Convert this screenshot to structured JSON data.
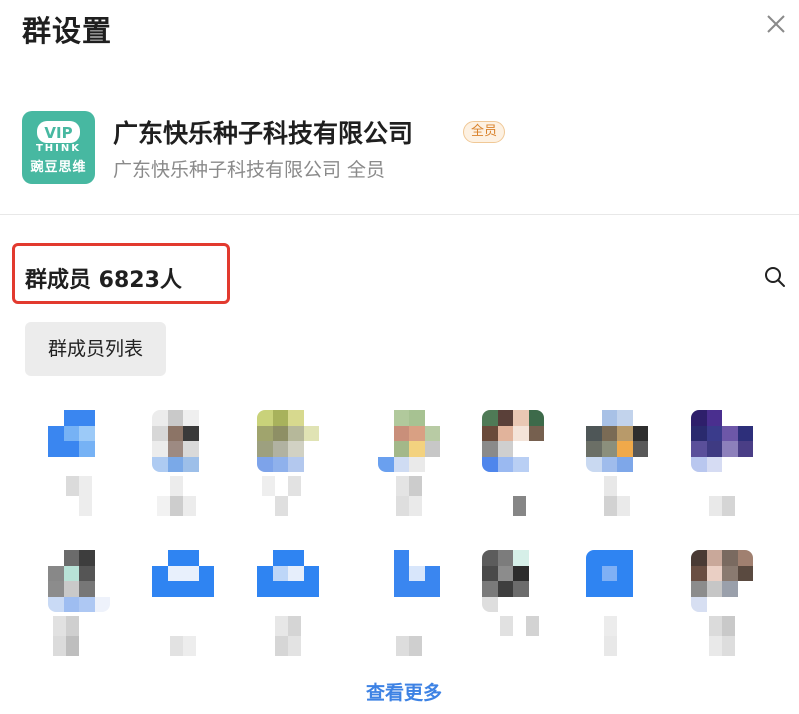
{
  "header": {
    "title": "群设置",
    "close_icon": "close-icon"
  },
  "group": {
    "logo": {
      "brand": "VIP",
      "think": "THINK",
      "cn": "豌豆思维",
      "color": "#47b8a1"
    },
    "name": "广东快乐种子科技有限公司",
    "badge": "全员",
    "subtitle": "广东快乐种子科技有限公司 全员"
  },
  "members": {
    "title": "群成员 6823人",
    "search_icon": "search-icon",
    "list_button": "群成员列表",
    "more_link": "查看更多",
    "items": [
      {
        "avatar": [
          "#ffffff",
          "#3a86f0",
          "#3a86f0",
          "#ffffff",
          "#3a86f0",
          "#76b2f5",
          "#9ccaf8",
          "#ffffff",
          "#3a86f0",
          "#3a86f0",
          "#76b2f5",
          "#ffffff",
          "#ffffff",
          "#ffffff",
          "#ffffff",
          "#ffffff"
        ],
        "name": [
          "#ffffff",
          "#ffffff",
          "#cfcfcf",
          "#e8e8e8",
          "#ffffff",
          "#ffffff",
          "#ffffff",
          "#ffffff",
          "#ffffff",
          "#e8e8e8",
          "#ffffff",
          "#ffffff"
        ]
      },
      {
        "avatar": [
          "#ececec",
          "#c9c9c9",
          "#efefef",
          "#ffffff",
          "#d7d7d7",
          "#8c7466",
          "#3a3a3a",
          "#ffffff",
          "#ececec",
          "#9d8a82",
          "#d9d9d9",
          "#ffffff",
          "#aecbf2",
          "#7aa9e8",
          "#9dbfe9",
          "#ffffff"
        ],
        "name": [
          "#ffffff",
          "#ffffff",
          "#e6e6e6",
          "#ffffff",
          "#ffffff",
          "#ffffff",
          "#ffffff",
          "#eeeeee",
          "#bdbdbd",
          "#e6e6e6",
          "#ffffff",
          "#ffffff"
        ]
      },
      {
        "avatar": [
          "#c9d27a",
          "#a8b25c",
          "#d7d98e",
          "#ffffff",
          "#a0a46d",
          "#8e8f65",
          "#b6b89a",
          "#e0e3b4",
          "#9da07f",
          "#b1b2a1",
          "#d1d1c3",
          "#ffffff",
          "#7da3ea",
          "#8fb1ec",
          "#b3c8ee",
          "#ffffff"
        ],
        "name": [
          "#ffffff",
          "#e9e9e9",
          "#ffffff",
          "#d9d9d9",
          "#ffffff",
          "#ffffff",
          "#ffffff",
          "#ffffff",
          "#d5d5d5",
          "#ffffff",
          "#ffffff",
          "#ffffff"
        ]
      },
      {
        "avatar": [
          "#ffffff",
          "#b1c99c",
          "#a7c292",
          "#ffffff",
          "#ffffff",
          "#c98f7a",
          "#d9a083",
          "#b8cba4",
          "#ffffff",
          "#a3b889",
          "#f3d27f",
          "#c7c7c7",
          "#6aa0ef",
          "#cfdcf3",
          "#eaeaea",
          "#ffffff"
        ],
        "name": [
          "#ffffff",
          "#ffffff",
          "#dcdcdc",
          "#bcbcbc",
          "#ffffff",
          "#ffffff",
          "#ffffff",
          "#ffffff",
          "#d4d4d4",
          "#e3e3e3",
          "#ffffff",
          "#ffffff"
        ]
      },
      {
        "avatar": [
          "#4f7a56",
          "#5a4039",
          "#e9c8b4",
          "#3d6a4a",
          "#6a4a3a",
          "#e1b39b",
          "#f4e4d9",
          "#76604f",
          "#8a8a8a",
          "#cfcfcf",
          "#ffffff",
          "#ffffff",
          "#4f86ec",
          "#9ab9f1",
          "#b9cff4",
          "#ffffff"
        ],
        "name": [
          "#ffffff",
          "#ffffff",
          "#ffffff",
          "#ffffff",
          "#ffffff",
          "#ffffff",
          "#ffffff",
          "#ffffff",
          "#ffffff",
          "#5e5e5e",
          "#ffffff",
          "#ffffff"
        ]
      },
      {
        "avatar": [
          "#ffffff",
          "#a8c1e6",
          "#c2d3ec",
          "#ffffff",
          "#4e5657",
          "#7a6b55",
          "#b89a6a",
          "#2e2e2e",
          "#6b6f66",
          "#8b8f7c",
          "#f0a94a",
          "#595959",
          "#c9d9f1",
          "#9fbcec",
          "#7ea7e9",
          "#ffffff"
        ],
        "name": [
          "#ffffff",
          "#ffffff",
          "#e1e1e1",
          "#ffffff",
          "#ffffff",
          "#ffffff",
          "#ffffff",
          "#ffffff",
          "#c4c4c4",
          "#e4e4e4",
          "#ffffff",
          "#ffffff"
        ]
      },
      {
        "avatar": [
          "#2e1f6b",
          "#4a2f8f",
          "#ffffff",
          "#ffffff",
          "#2a2a6e",
          "#3a3b8b",
          "#6d57a8",
          "#2d2f7a",
          "#5a4f9a",
          "#3e3a82",
          "#8d80bb",
          "#4a3e86",
          "#b9c7ef",
          "#d6dcf3",
          "#ffffff",
          "#ffffff"
        ],
        "name": [
          "#ffffff",
          "#ffffff",
          "#ffffff",
          "#ffffff",
          "#ffffff",
          "#ffffff",
          "#ffffff",
          "#ffffff",
          "#e2e2e2",
          "#c7c7c7",
          "#ffffff",
          "#ffffff"
        ]
      },
      {
        "avatar": [
          "#ffffff",
          "#6b6b6b",
          "#3d3d3d",
          "#ffffff",
          "#888888",
          "#b8e2d7",
          "#555555",
          "#ffffff",
          "#8c8c8c",
          "#c9c9c9",
          "#777777",
          "#ffffff",
          "#c9daf5",
          "#9ebdf1",
          "#aec8f3",
          "#eef2fb"
        ],
        "name": [
          "#ffffff",
          "#d8d8d8",
          "#bfbfbf",
          "#ffffff",
          "#ffffff",
          "#ffffff",
          "#ffffff",
          "#cfcfcf",
          "#a9a9a9",
          "#ffffff",
          "#ffffff",
          "#ffffff"
        ]
      },
      {
        "avatar": [
          "#ffffff",
          "#2f84f2",
          "#2f84f2",
          "#ffffff",
          "#2f84f2",
          "#e8f0fc",
          "#e8f0fc",
          "#2f84f2",
          "#2f84f2",
          "#2f84f2",
          "#2f84f2",
          "#2f84f2",
          "#ffffff",
          "#ffffff",
          "#ffffff",
          "#ffffff"
        ],
        "name": [
          "#ffffff",
          "#ffffff",
          "#ffffff",
          "#ffffff",
          "#ffffff",
          "#ffffff",
          "#ffffff",
          "#ffffff",
          "#d9d9d9",
          "#e8e8e8",
          "#ffffff",
          "#ffffff"
        ]
      },
      {
        "avatar": [
          "#ffffff",
          "#2f84f2",
          "#2f84f2",
          "#ffffff",
          "#2f84f2",
          "#bdd6f8",
          "#e6eefb",
          "#2f84f2",
          "#2f84f2",
          "#2f84f2",
          "#2f84f2",
          "#2f84f2",
          "#ffffff",
          "#ffffff",
          "#ffffff",
          "#ffffff"
        ],
        "name": [
          "#ffffff",
          "#ffffff",
          "#e0e0e0",
          "#c8c8c8",
          "#ffffff",
          "#ffffff",
          "#ffffff",
          "#ffffff",
          "#c9c9c9",
          "#dadada",
          "#ffffff",
          "#ffffff"
        ]
      },
      {
        "avatar": [
          "#ffffff",
          "#3a86f0",
          "#ffffff",
          "#ffffff",
          "#ffffff",
          "#3a86f0",
          "#d8e6fb",
          "#3a86f0",
          "#ffffff",
          "#3a86f0",
          "#3a86f0",
          "#3a86f0",
          "#ffffff",
          "#ffffff",
          "#ffffff",
          "#ffffff"
        ],
        "name": [
          "#ffffff",
          "#ffffff",
          "#ffffff",
          "#ffffff",
          "#ffffff",
          "#ffffff",
          "#ffffff",
          "#ffffff",
          "#d2d2d2",
          "#bfbfbf",
          "#ffffff",
          "#ffffff"
        ]
      },
      {
        "avatar": [
          "#5c5c5c",
          "#7c7c7c",
          "#d6efe8",
          "#ffffff",
          "#4a4a4a",
          "#8c8c8c",
          "#2c2c2c",
          "#ffffff",
          "#7a7a7a",
          "#3e3e3e",
          "#6c6c6c",
          "#ffffff",
          "#dedede",
          "#ffffff",
          "#ffffff",
          "#ffffff"
        ],
        "name": [
          "#ffffff",
          "#ffffff",
          "#d8d8d8",
          "#ffffff",
          "#c5c5c5",
          "#ffffff",
          "#ffffff",
          "#ffffff",
          "#ffffff",
          "#ffffff",
          "#ffffff",
          "#ffffff"
        ]
      },
      {
        "avatar": [
          "#2f84f2",
          "#2f84f2",
          "#2f84f2",
          "#ffffff",
          "#2f84f2",
          "#7fb0f5",
          "#2f84f2",
          "#ffffff",
          "#2f84f2",
          "#2f84f2",
          "#2f84f2",
          "#ffffff",
          "#ffffff",
          "#ffffff",
          "#ffffff",
          "#ffffff"
        ],
        "name": [
          "#ffffff",
          "#ffffff",
          "#e6e6e6",
          "#ffffff",
          "#ffffff",
          "#ffffff",
          "#ffffff",
          "#ffffff",
          "#e1e1e1",
          "#ffffff",
          "#ffffff",
          "#ffffff"
        ]
      },
      {
        "avatar": [
          "#4a3a34",
          "#c9a89a",
          "#7a6a60",
          "#a08070",
          "#6a4e42",
          "#eacfc4",
          "#8a7a70",
          "#5a4a40",
          "#8c8c8c",
          "#c6c6c6",
          "#9aa0ab",
          "#ffffff",
          "#d7dff2",
          "#ffffff",
          "#ffffff",
          "#ffffff"
        ],
        "name": [
          "#ffffff",
          "#ffffff",
          "#cfcfcf",
          "#b8b8b8",
          "#ffffff",
          "#ffffff",
          "#ffffff",
          "#ffffff",
          "#e2e2e2",
          "#d2d2d2",
          "#ffffff",
          "#ffffff"
        ]
      }
    ]
  }
}
